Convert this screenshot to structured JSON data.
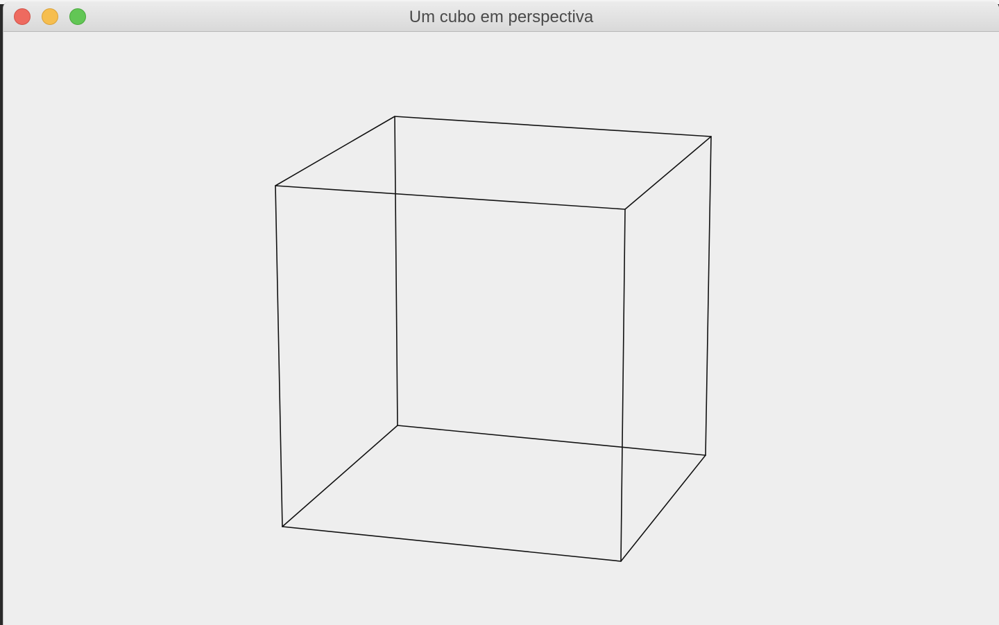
{
  "window": {
    "title": "Um cubo em perspectiva",
    "controls": {
      "close_icon": "close-circle-icon",
      "minimize_icon": "minimize-circle-icon",
      "zoom_icon": "zoom-circle-icon",
      "close_color": "#ee6a5f",
      "minimize_color": "#f6be4f",
      "zoom_color": "#62c655"
    }
  },
  "canvas": {
    "background": "#eeeeee",
    "figure": "wireframe-cube",
    "stroke_color": "#111111"
  }
}
